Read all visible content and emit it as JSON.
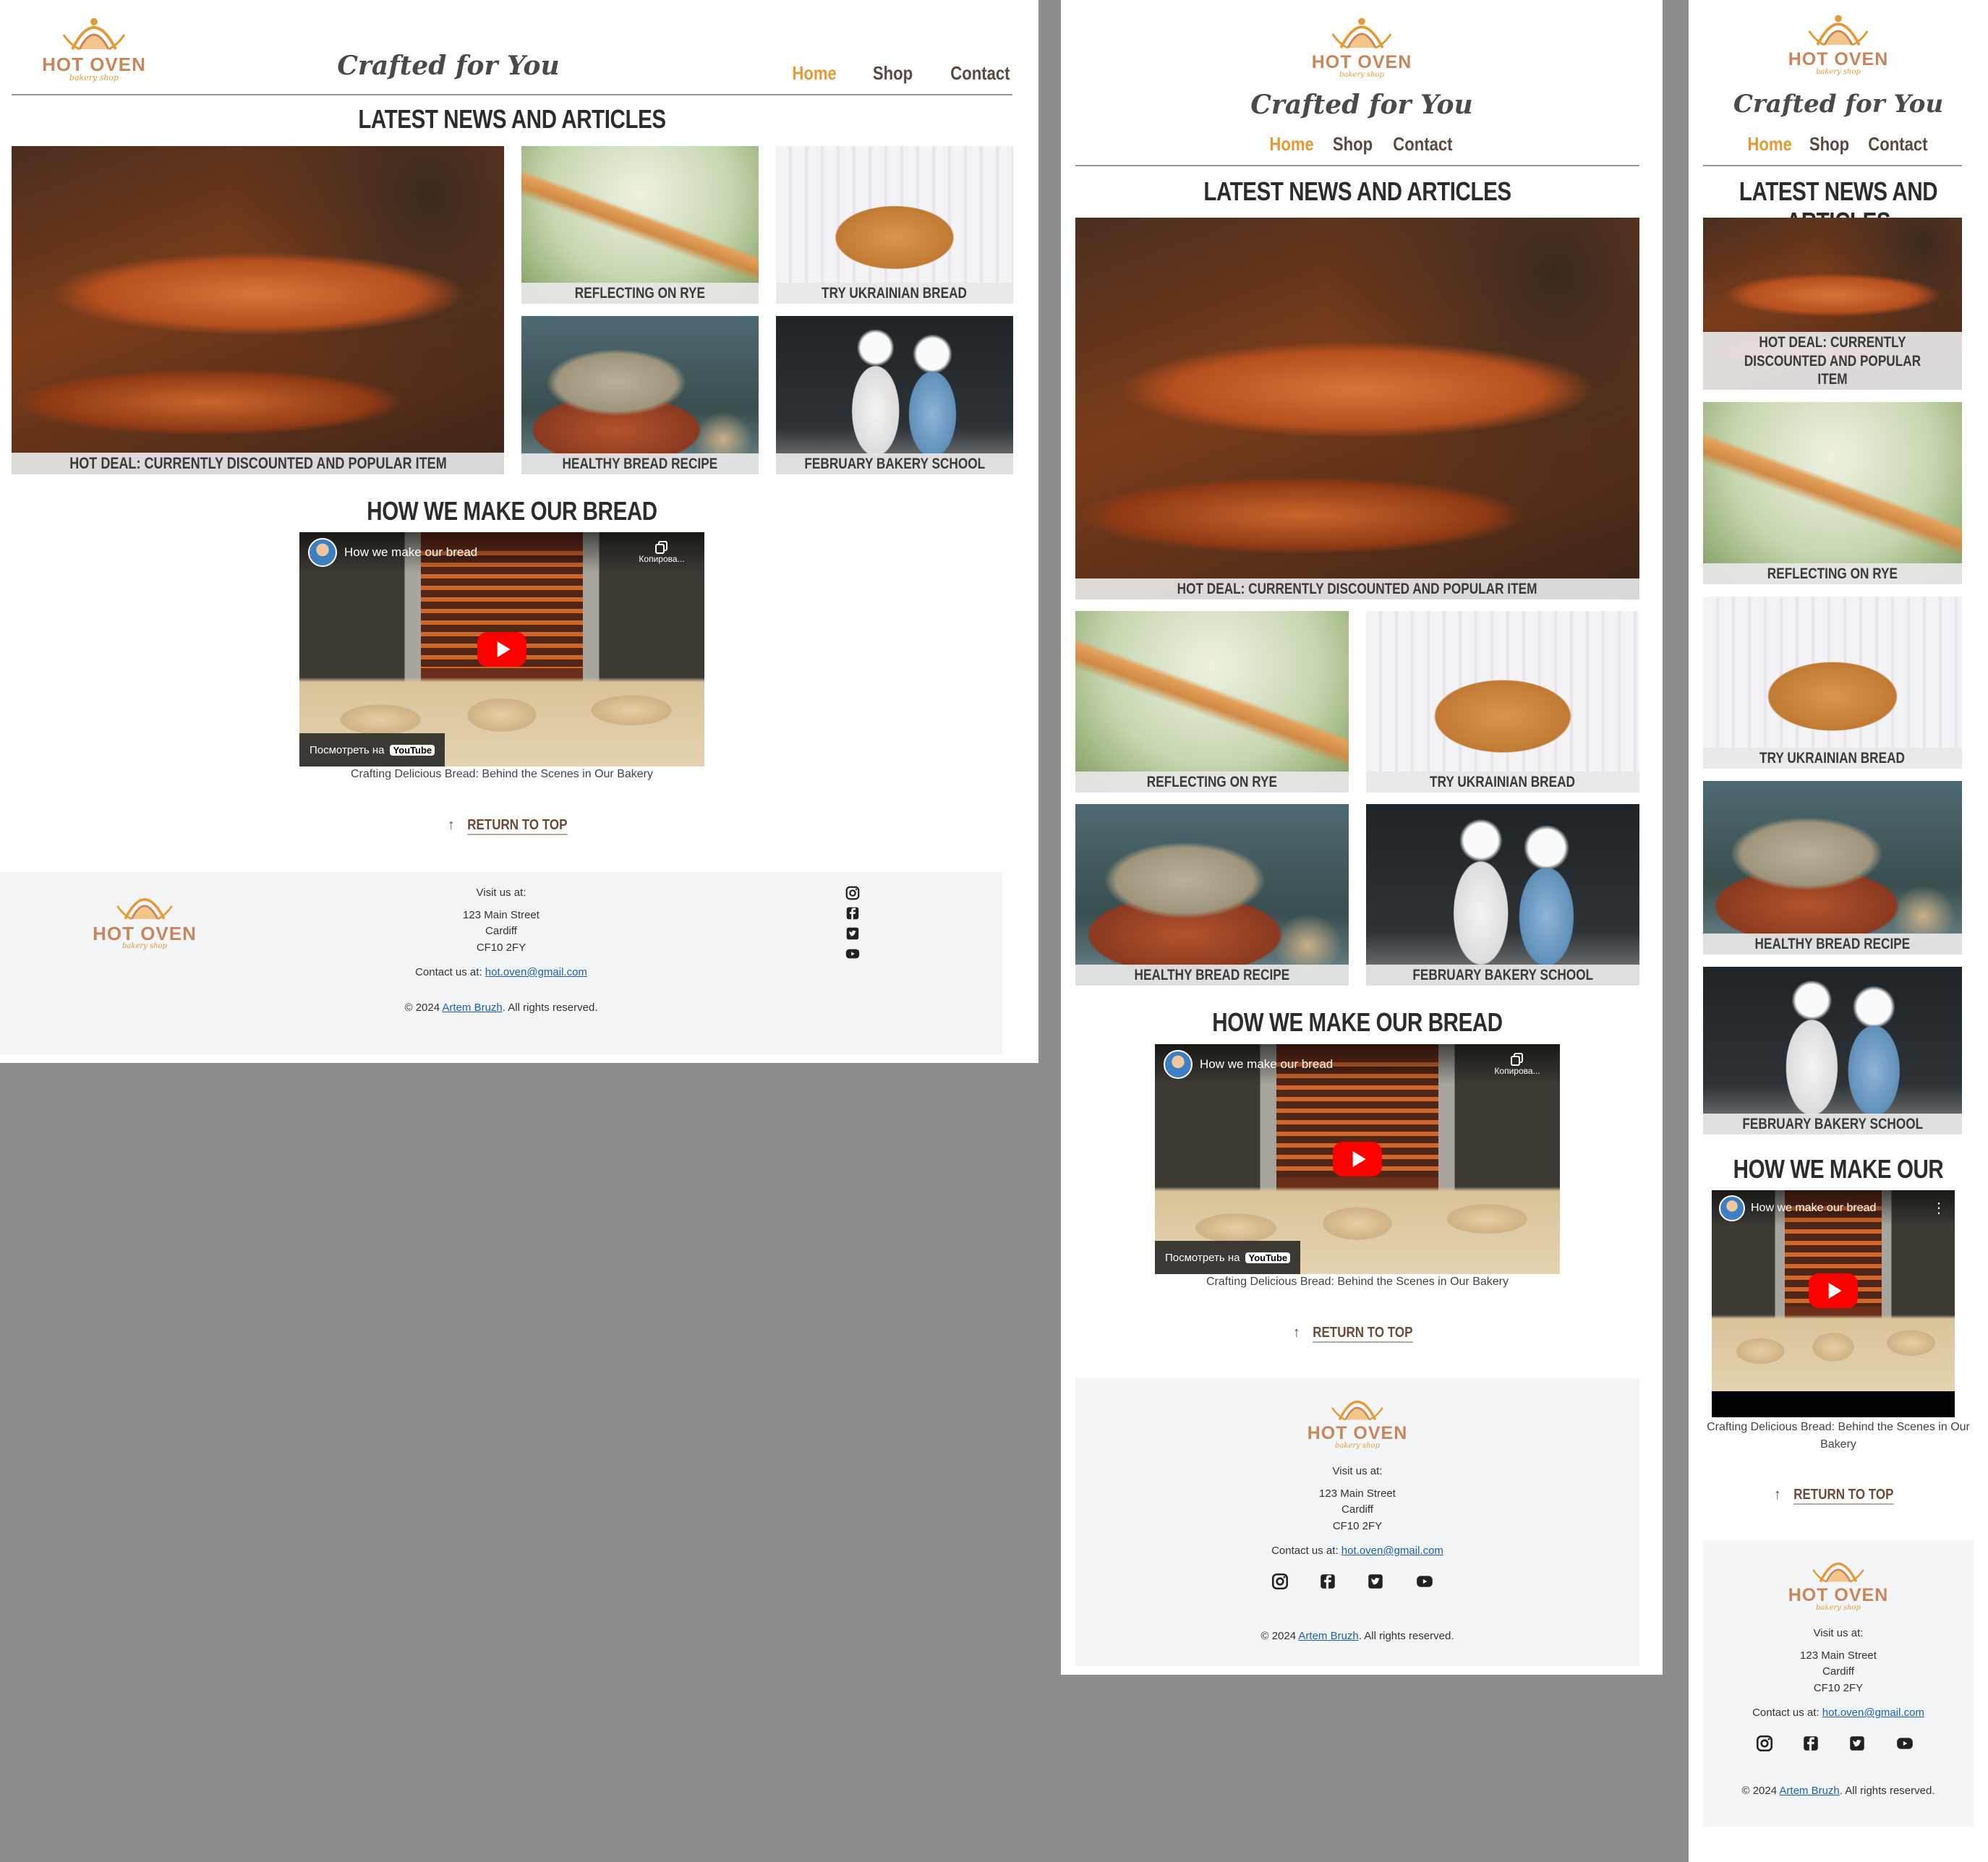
{
  "brand": {
    "name": "HOT OVEN",
    "sub": "bakery shop",
    "tagline": "Crafted for You"
  },
  "nav": [
    {
      "label": "Home",
      "active": true
    },
    {
      "label": "Shop",
      "active": false
    },
    {
      "label": "Contact",
      "active": false
    }
  ],
  "news": {
    "heading": "Latest News and Articles",
    "items": [
      {
        "caption": "HOT DEAL: CURRENTLY DISCOUNTED AND POPULAR ITEM"
      },
      {
        "caption": "REFLECTING ON RYE"
      },
      {
        "caption": "TRY UKRAINIAN BREAD"
      },
      {
        "caption": "HEALTHY BREAD RECIPE"
      },
      {
        "caption": "FEBRUARY BAKERY SCHOOL"
      }
    ]
  },
  "video": {
    "heading": "How We Make Our Bread",
    "title": "How we make our bread",
    "copy_label": "Копирова...",
    "watch_on": "Посмотреть на",
    "youtube": "YouTube",
    "caption": "Crafting Delicious Bread: Behind the Scenes in Our Bakery"
  },
  "return_to_top": "RETURN TO TOP",
  "footer": {
    "visit": "Visit us at:",
    "street": "123 Main Street",
    "city": "Cardiff",
    "postcode": "CF10 2FY",
    "contact_prefix": "Contact us at:",
    "email": "hot.oven@gmail.com",
    "copyright_prefix": "© 2024",
    "author": "Artem Bruzh",
    "copyright_suffix": ". All rights reserved."
  },
  "social": [
    "instagram-icon",
    "facebook-icon",
    "twitter-icon",
    "youtube-icon"
  ],
  "colors": {
    "accent": "#e59a35",
    "brand": "#c8865a",
    "footer_bg": "#f4f5f7",
    "backdrop": "#8d8d8d"
  }
}
